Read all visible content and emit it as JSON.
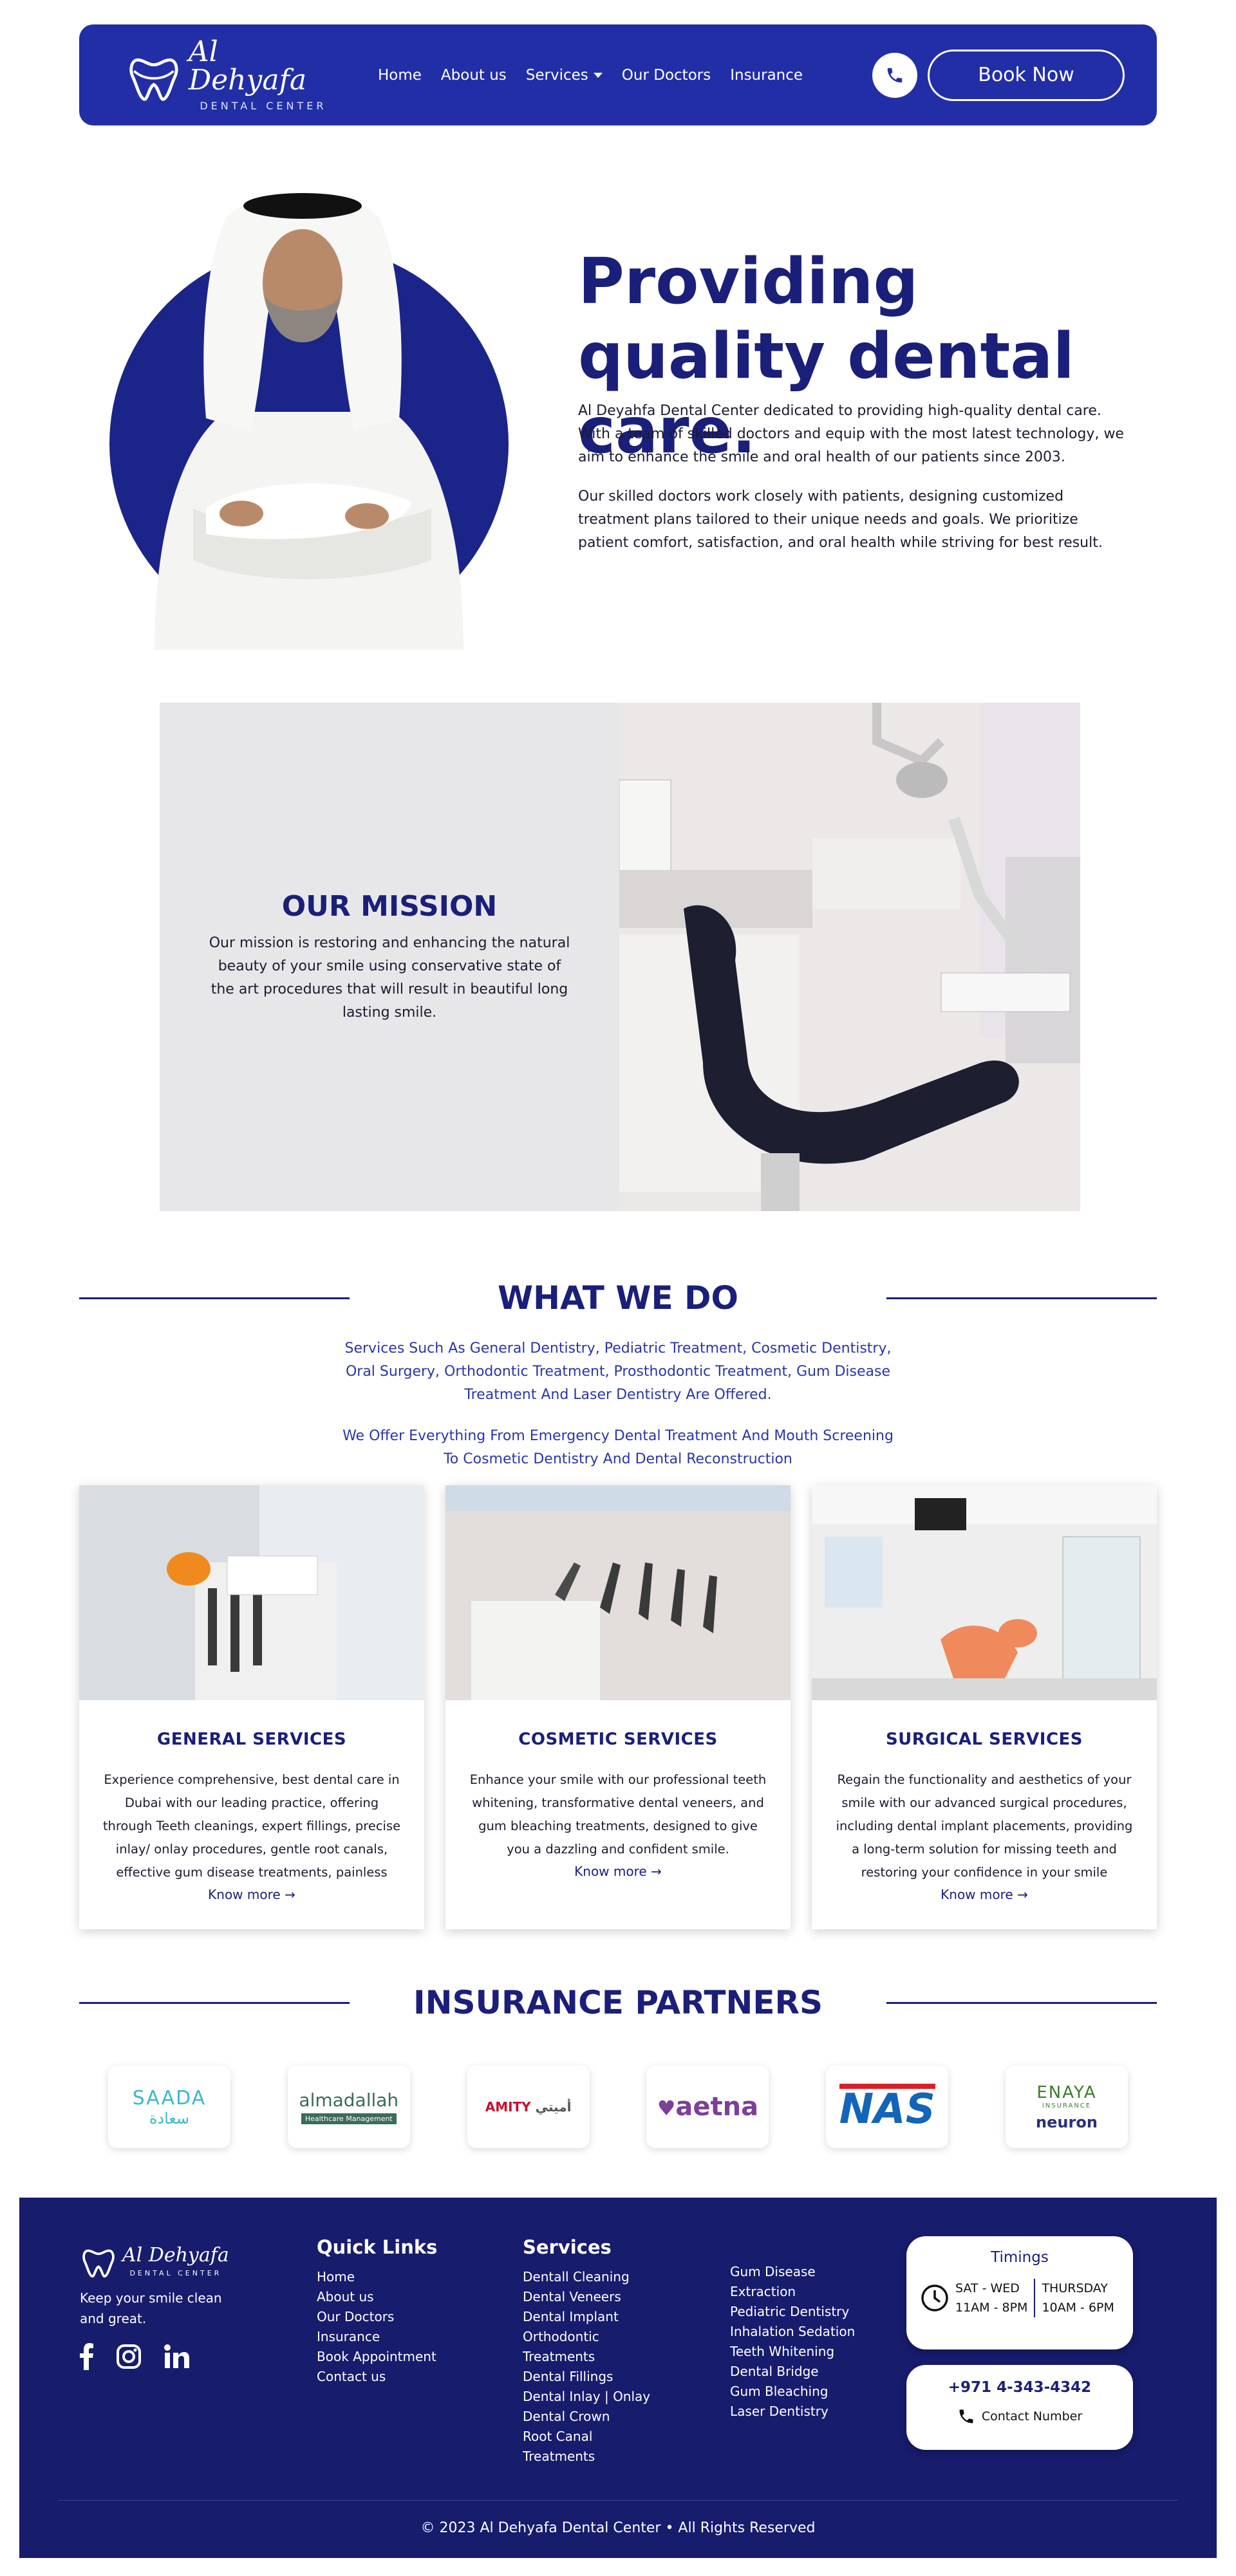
{
  "nav": {
    "brand": "Al Dehyafa",
    "brand_sub": "DENTAL CENTER",
    "links": [
      "Home",
      "About us",
      "Services",
      "Our Doctors",
      "Insurance"
    ],
    "book_label": "Book Now"
  },
  "hero": {
    "title": "Providing quality dental care.",
    "paragraph1": "Al Deyahfa Dental Center dedicated to providing high-quality dental care. With a team of skilled doctors and equip with the most latest technology, we aim to enhance the smile and oral health of our patients since 2003.",
    "paragraph2": "Our skilled doctors work closely with patients, designing customized treatment plans tailored to their unique needs and goals. We prioritize patient comfort, satisfaction, and oral health while striving for best result."
  },
  "mission": {
    "title": "OUR MISSION",
    "text": "Our mission is restoring and enhancing the natural beauty of your smile using conservative state of the art procedures that will result in beautiful long lasting smile."
  },
  "what_we_do": {
    "title": "WHAT WE DO",
    "text1": "Services Such As General Dentistry, Pediatric Treatment, Cosmetic Dentistry, Oral Surgery, Orthodontic Treatment, Prosthodontic Treatment, Gum Disease Treatment And Laser Dentistry Are Offered.",
    "text2": "We Offer Everything From Emergency Dental Treatment And Mouth Screening To Cosmetic Dentistry And Dental Reconstruction"
  },
  "cards": [
    {
      "title": "GENERAL SERVICES",
      "text": "Experience comprehensive, best dental care in Dubai with our leading practice, offering through Teeth cleanings, expert fillings, precise inlay/ onlay procedures, gentle root canals, effective gum disease treatments, painless",
      "more": "Know more"
    },
    {
      "title": "COSMETIC SERVICES",
      "text": "Enhance your smile with our professional teeth whitening, transformative dental veneers, and gum bleaching treatments, designed to give you a dazzling and confident smile.",
      "more": "Know more"
    },
    {
      "title": "SURGICAL SERVICES",
      "text": "Regain the functionality and aesthetics of your smile with our advanced surgical procedures, including dental implant placements, providing a long-term solution for missing teeth and restoring your confidence in your smile",
      "more": "Know more"
    }
  ],
  "insurance": {
    "title": "INSURANCE PARTNERS",
    "partners": [
      {
        "name": "SAADA",
        "sub": "سعادة"
      },
      {
        "name": "almadallah",
        "sub": "Healthcare Management"
      },
      {
        "name": "AMITY",
        "sub": "أميتي"
      },
      {
        "name": "aetna",
        "sub": ""
      },
      {
        "name": "NAS",
        "sub": ""
      },
      {
        "name": "ENAYA",
        "sub": "INSURANCE",
        "extra": "neuron"
      }
    ]
  },
  "footer": {
    "brand": "Al Dehyafa",
    "brand_sub": "DENTAL CENTER",
    "tagline": "Keep your smile clean and great.",
    "quick_links_title": "Quick Links",
    "quick_links": [
      "Home",
      "About us",
      "Our Doctors",
      "Insurance",
      "Book Appointment",
      "Contact us"
    ],
    "services_title": "Services",
    "services_col1": [
      "Dentall Cleaning",
      "Dental Veneers",
      "Dental Implant",
      "Orthodontic",
      "Treatments",
      "Dental Fillings",
      "Dental Inlay | Onlay",
      "Dental Crown",
      "Root Canal",
      "Treatments"
    ],
    "services_col2": [
      "Gum Disease",
      "Extraction",
      "Pediatric Dentistry",
      "Inhalation Sedation",
      "Teeth Whitening",
      "Dental Bridge",
      "Gum Bleaching",
      "Laser Dentistry"
    ],
    "timings_title": "Timings",
    "timing1_days": "SAT - WED",
    "timing1_hours": "11AM - 8PM",
    "timing2_days": "THURSDAY",
    "timing2_hours": "10AM - 6PM",
    "phone": "+971 4-343-4342",
    "phone_label": "Contact Number",
    "copyright": "© 2023 Al Dehyafa Dental Center • All Rights Reserved"
  },
  "colors": {
    "primary": "#222ea6",
    "dark": "#1a1f7a",
    "footer": "#171c6d"
  }
}
